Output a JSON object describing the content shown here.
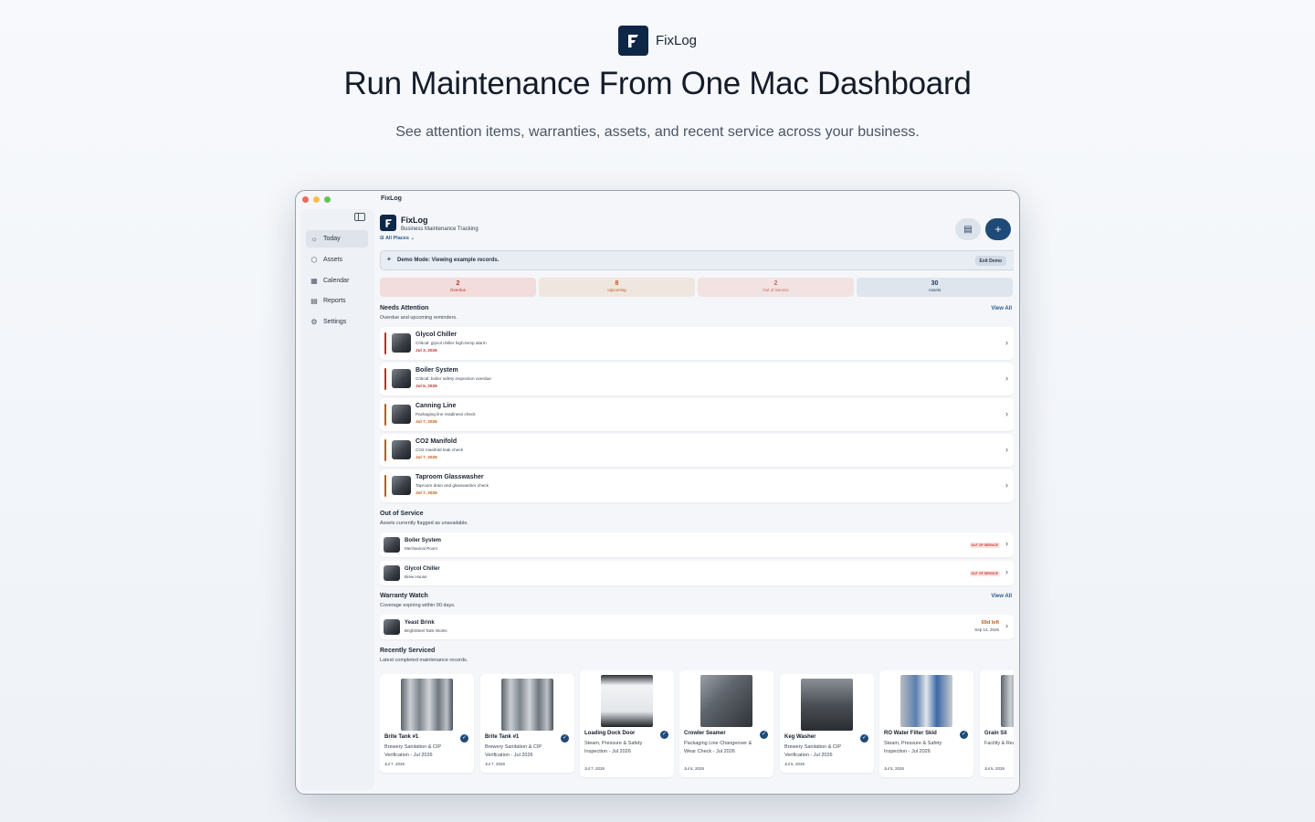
{
  "hero": {
    "brand_name": "FixLog",
    "title": "Run Maintenance From One Mac Dashboard",
    "subtitle": "See attention items, warranties, assets, and recent service across your business."
  },
  "window": {
    "title": "FixLog"
  },
  "sidebar": {
    "items": [
      {
        "label": "Today",
        "icon": "sun-icon",
        "active": true
      },
      {
        "label": "Assets",
        "icon": "cube-icon"
      },
      {
        "label": "Calendar",
        "icon": "calendar-icon"
      },
      {
        "label": "Reports",
        "icon": "document-icon"
      },
      {
        "label": "Settings",
        "icon": "gear-icon"
      }
    ]
  },
  "header": {
    "app_name": "FixLog",
    "tagline": "Business Maintenance Tracking",
    "places": "All Places"
  },
  "demo": {
    "text": "Demo Mode: Viewing example records.",
    "exit_label": "Exit Demo"
  },
  "stats": [
    {
      "value": "2",
      "label": "Overdue",
      "color": "#b8322a",
      "bg": "#f3dcdc"
    },
    {
      "value": "8",
      "label": "Upcoming",
      "color": "#c05a14",
      "bg": "#efe6df"
    },
    {
      "value": "2",
      "label": "Out of Service",
      "color": "#c66a64",
      "bg": "#f2e2e2"
    },
    {
      "value": "30",
      "label": "Assets",
      "color": "#1f3e63",
      "bg": "#dfe5ec"
    }
  ],
  "needs_attention": {
    "title": "Needs Attention",
    "subtitle": "Overdue and upcoming reminders.",
    "view_all": "View All",
    "items": [
      {
        "name": "Glycol Chiller",
        "desc": "Critical: glycol chiller high-temp alarm",
        "date": "Jul 3, 2026",
        "color": "#b8322a"
      },
      {
        "name": "Boiler System",
        "desc": "Critical: boiler safety inspection overdue",
        "date": "Jul 5, 2026",
        "color": "#b8322a"
      },
      {
        "name": "Canning Line",
        "desc": "Packaging line readiness check",
        "date": "Jul 7, 2026",
        "color": "#c05a14"
      },
      {
        "name": "CO2 Manifold",
        "desc": "CO2 manifold leak check",
        "date": "Jul 7, 2026",
        "color": "#c05a14"
      },
      {
        "name": "Taproom Glasswasher",
        "desc": "Taproom drain and glasswasher check",
        "date": "Jul 7, 2026",
        "color": "#c05a14"
      }
    ]
  },
  "out_of_service": {
    "title": "Out of Service",
    "subtitle": "Assets currently flagged as unavailable.",
    "badge": "OUT OF SERVICE",
    "items": [
      {
        "name": "Boiler System",
        "location": "Mechanical Room"
      },
      {
        "name": "Glycol Chiller",
        "location": "Brew House"
      }
    ]
  },
  "warranty": {
    "title": "Warranty Watch",
    "subtitle": "Coverage expiring within 90 days.",
    "view_all": "View All",
    "items": [
      {
        "name": "Yeast Brink",
        "vendor": "BrightSteel Tank Works",
        "left": "69d left",
        "date": "Sep 14, 2026"
      }
    ]
  },
  "recently_serviced": {
    "title": "Recently Serviced",
    "subtitle": "Latest completed maintenance records.",
    "cards": [
      {
        "title": "Brite Tank #1",
        "desc": "Brewery Sanitation & CIP Verification - Jul 2026",
        "date": "Jul 7, 2026"
      },
      {
        "title": "Brite Tank #1",
        "desc": "Brewery Sanitation & CIP Verification - Jul 2026",
        "date": "Jul 7, 2026"
      },
      {
        "title": "Loading Dock Door",
        "desc": "Steam, Pressure & Safety Inspection - Jul 2026",
        "date": "Jul 7, 2026"
      },
      {
        "title": "Crowler Seamer",
        "desc": "Packaging Line Changeover & Wear Check - Jul 2026",
        "date": "Jul 6, 2026"
      },
      {
        "title": "Keg Washer",
        "desc": "Brewery Sanitation & CIP Verification - Jul 2026",
        "date": "Jul 6, 2026"
      },
      {
        "title": "RO Water Filter Skid",
        "desc": "Steam, Pressure & Safety Inspection - Jul 2026",
        "date": "Jul 5, 2026"
      },
      {
        "title": "Grain Sil",
        "desc": "Facility & Readines 2026",
        "date": "Jul 5, 2026"
      }
    ]
  }
}
